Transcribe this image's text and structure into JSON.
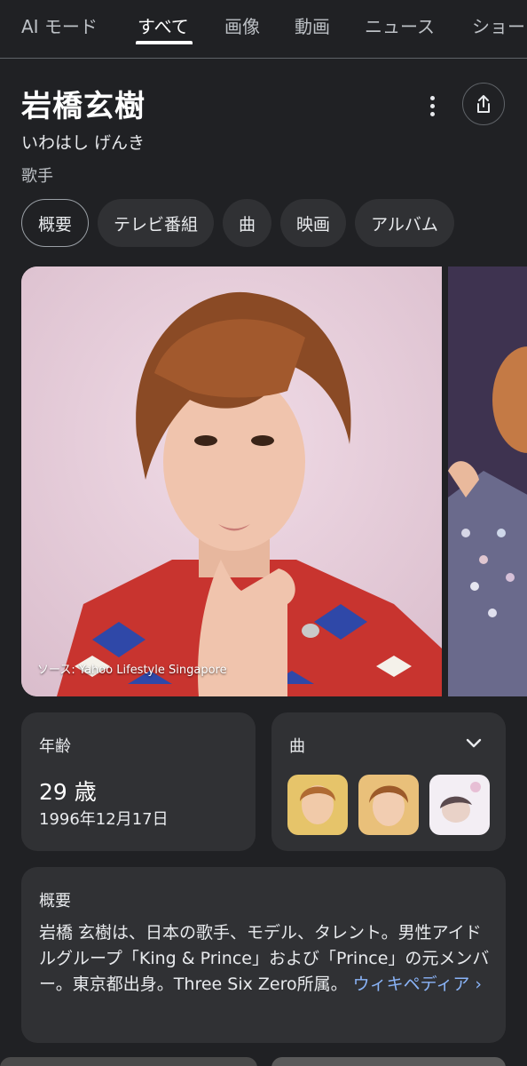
{
  "nav": {
    "tabs": [
      {
        "label": "AI モード"
      },
      {
        "label": "すべて"
      },
      {
        "label": "画像"
      },
      {
        "label": "動画"
      },
      {
        "label": "ニュース"
      },
      {
        "label": "ショー"
      }
    ],
    "active_index": 1
  },
  "entity": {
    "name": "岩橋玄樹",
    "reading": "いわはし げんき",
    "category": "歌手"
  },
  "chips": [
    {
      "label": "概要"
    },
    {
      "label": "テレビ番組"
    },
    {
      "label": "曲"
    },
    {
      "label": "映画"
    },
    {
      "label": "アルバム"
    }
  ],
  "image": {
    "source": "ソース: Yahoo Lifestyle Singapore"
  },
  "age_card": {
    "label": "年齢",
    "value": "29 歳",
    "birthdate": "1996年12月17日"
  },
  "song_card": {
    "label": "曲"
  },
  "overview_card": {
    "label": "概要",
    "text": "岩橋 玄樹は、日本の歌手、モデル、タレント。男性アイドルグループ「King & Prince」および「Prince」の元メンバー。東京都出身。Three Six Zero所属。",
    "link": "ウィキペディア ›"
  },
  "colors": {
    "background": "#202124",
    "card": "#303134",
    "link": "#8ab4f8"
  },
  "icons": [
    "more-vert-icon",
    "share-icon",
    "chevron-down-icon"
  ]
}
